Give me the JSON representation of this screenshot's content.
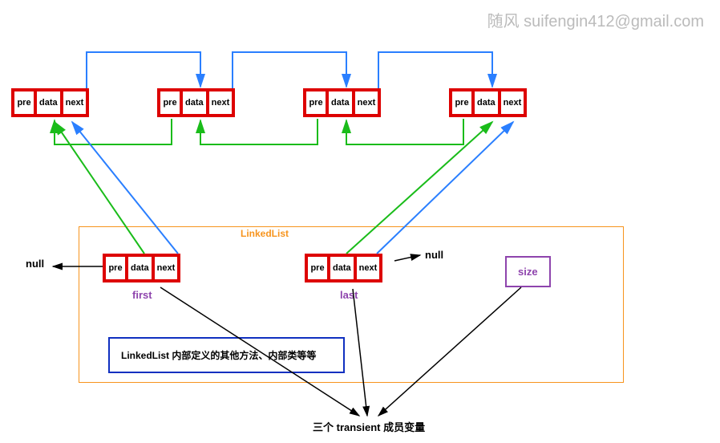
{
  "watermark": "随风 suifengin412@gmail.com",
  "node_cells": {
    "pre": "pre",
    "data": "data",
    "next": "next"
  },
  "container_label": "LinkedList",
  "first_label": "first",
  "last_label": "last",
  "size_label": "size",
  "null_left": "null",
  "null_right": "null",
  "inner_box_text": "LinkedList 内部定义的其他方法、内部类等等",
  "bottom_text": "三个 transient 成员变量",
  "diagram": {
    "description": "Java LinkedList 内部结构示意图：双向链表节点（pre/data/next），LinkedList 持有 first、last、size 三个 transient 成员变量",
    "top_chain_nodes": 4,
    "linkedlist_members": [
      "first",
      "last",
      "size"
    ],
    "member_modifier": "transient",
    "first_pre": "null",
    "last_next": "null"
  }
}
